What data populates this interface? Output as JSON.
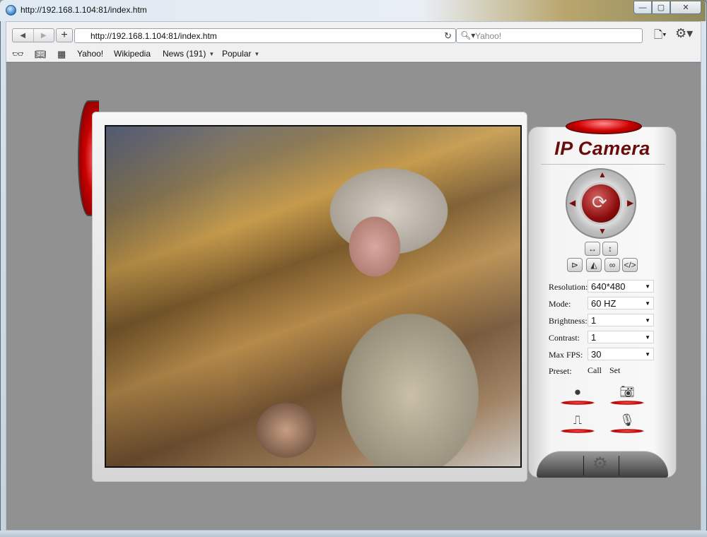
{
  "window": {
    "title": "http://192.168.1.104:81/index.htm",
    "controls": [
      "—",
      "▢",
      "✕"
    ]
  },
  "toolbar": {
    "back": "◀",
    "forward": "▶",
    "add": "+",
    "url": "http://192.168.1.104:81/index.htm",
    "search_placeholder": "Yahoo!"
  },
  "bookmarks": [
    {
      "label": "Yahoo!"
    },
    {
      "label": "Wikipedia"
    },
    {
      "label": "News (191)",
      "dropdown": true
    },
    {
      "label": "Popular",
      "dropdown": true
    }
  ],
  "camera": {
    "title": "IP Camera",
    "fields": [
      {
        "label": "Resolution:",
        "value": "640*480"
      },
      {
        "label": "Mode:",
        "value": "60 HZ"
      },
      {
        "label": "Brightness:",
        "value": "1"
      },
      {
        "label": "Contrast:",
        "value": "1"
      },
      {
        "label": "Max FPS:",
        "value": "30"
      }
    ],
    "preset": {
      "label": "Preset:",
      "call": "Call",
      "set": "Set"
    }
  },
  "colors": {
    "accent_red": "#c90000",
    "title_red": "#6a0b0b",
    "content_gray": "#919191"
  }
}
